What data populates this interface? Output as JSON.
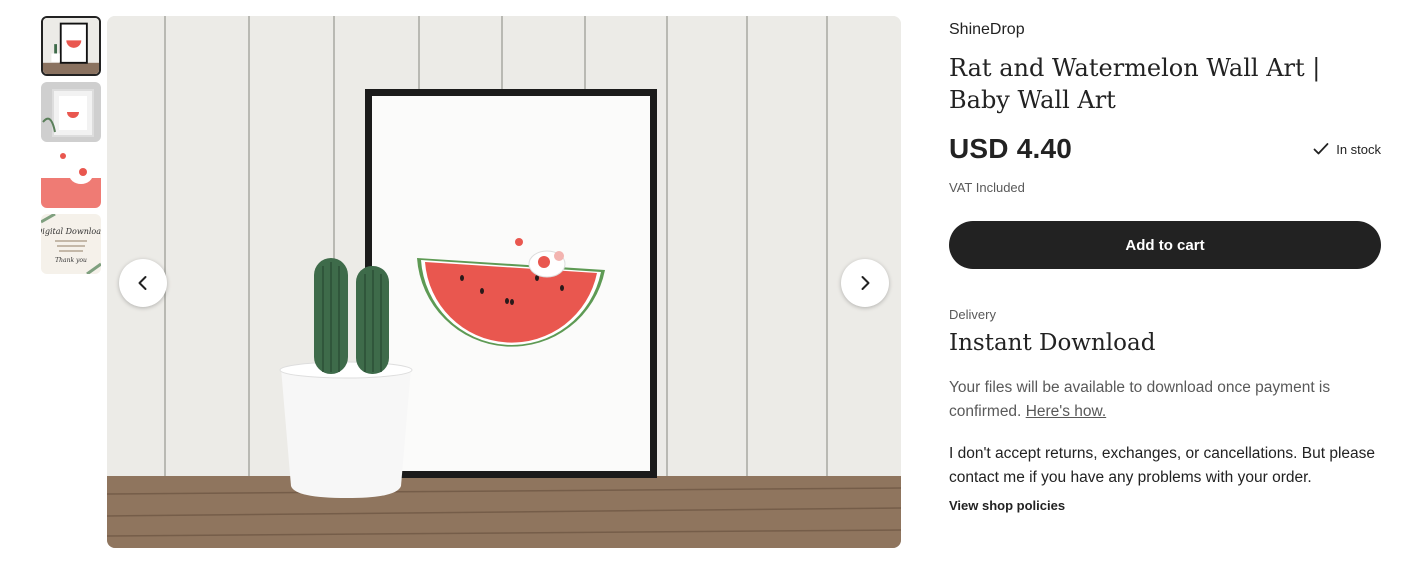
{
  "thumbnails": [
    {
      "alt": "framed watermelon print",
      "icon": "thumbnail-1"
    },
    {
      "alt": "framed print with plant",
      "icon": "thumbnail-2"
    },
    {
      "alt": "watermelon close-up",
      "icon": "thumbnail-3"
    },
    {
      "alt": "digital download card",
      "icon": "thumbnail-4"
    }
  ],
  "thumbnail_text": {
    "card_title": "Digital Download",
    "card_sign": "Thank you"
  },
  "gallery": {
    "prev_icon": "chevron-left-icon",
    "next_icon": "chevron-right-icon"
  },
  "listing": {
    "shop_name": "ShineDrop",
    "title": "Rat and Watermelon Wall Art | Baby Wall Art",
    "price": "USD 4.40",
    "stock": "In stock",
    "vat": "VAT Included",
    "add_to_cart": "Add to cart"
  },
  "delivery": {
    "label": "Delivery",
    "title": "Instant Download",
    "text": "Your files will be available to download once payment is confirmed.",
    "link": "Here's how.",
    "policy_text": "I don't accept returns, exchanges, or cancellations. But please contact me if you have any problems with your order.",
    "policies_link": "View shop policies"
  },
  "colors": {
    "button_bg": "#222222",
    "text_muted": "#595959",
    "watermelon": "#e9574f"
  }
}
